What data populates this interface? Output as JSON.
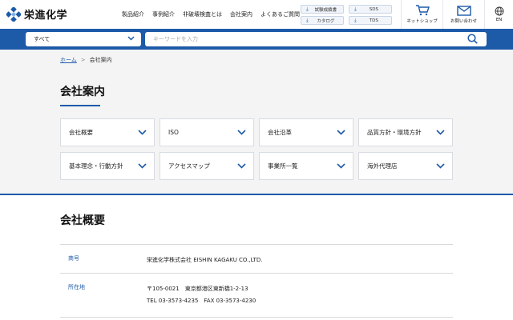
{
  "header": {
    "logo_text": "栄進化学",
    "nav": [
      "製品紹介",
      "事例紹介",
      "非破壊検査とは",
      "会社案内",
      "よくあるご質問"
    ],
    "downloads": [
      "試験成績書",
      "SDS",
      "カタログ",
      "TDS"
    ],
    "shop_label": "ネットショップ",
    "contact_label": "お問い合わせ",
    "lang_label": "EN",
    "brand_color": "#1d5aa8"
  },
  "search": {
    "category": "すべて",
    "placeholder": "キーワードを入力"
  },
  "breadcrumb": {
    "home": "ホーム",
    "separator": ">",
    "current": "会社案内"
  },
  "page_title": "会社案内",
  "menu": [
    "会社概要",
    "ISO",
    "会社沿革",
    "品質方針・環境方針",
    "基本理念・行動方針",
    "アクセスマップ",
    "事業所一覧",
    "海外代理店"
  ],
  "profile": {
    "title": "会社概要",
    "rows": [
      {
        "label": "商号",
        "lines": [
          "栄進化学株式会社 EISHIN KAGAKU CO.,LTD."
        ]
      },
      {
        "label": "所在地",
        "lines": [
          "〒105-0021　東京都港区東新橋1-2-13",
          "TEL 03-3573-4235　FAX 03-3573-4230"
        ]
      }
    ]
  }
}
